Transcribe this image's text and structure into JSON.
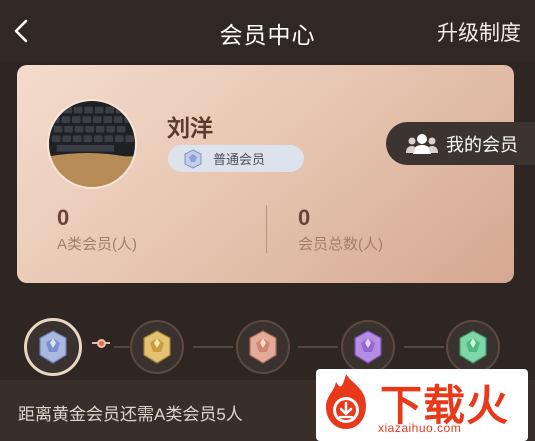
{
  "header": {
    "back_icon": "chevron-left-icon",
    "title": "会员中心",
    "upgrade_label": "升级制度"
  },
  "profile": {
    "name": "刘洋",
    "level_label": "普通会员",
    "level_icon": "silver-gem-icon"
  },
  "stats": [
    {
      "value": "0",
      "label": "A类会员(人)"
    },
    {
      "value": "0",
      "label": "会员总数(人)"
    }
  ],
  "my_members": {
    "label": "我的会员",
    "icon": "people-icon"
  },
  "levels": [
    {
      "icon": "silver-gem-icon",
      "color": "#8da1d6",
      "active": true
    },
    {
      "icon": "gold-gem-icon",
      "color": "#d9b25c",
      "active": false
    },
    {
      "icon": "rose-gem-icon",
      "color": "#d99a86",
      "active": false
    },
    {
      "icon": "purple-gem-icon",
      "color": "#a77ad9",
      "active": false
    },
    {
      "icon": "green-gem-icon",
      "color": "#5fc38e",
      "active": false
    }
  ],
  "hint": "距离黄金会员还需A类会员5人",
  "watermark": {
    "text": "下载火",
    "url": "xiazaihuo.com"
  },
  "colors": {
    "background": "#2d2623",
    "card_accent": "#e8c7b3",
    "progress_dot": "#e46a46",
    "watermark_red": "#e8391b"
  }
}
